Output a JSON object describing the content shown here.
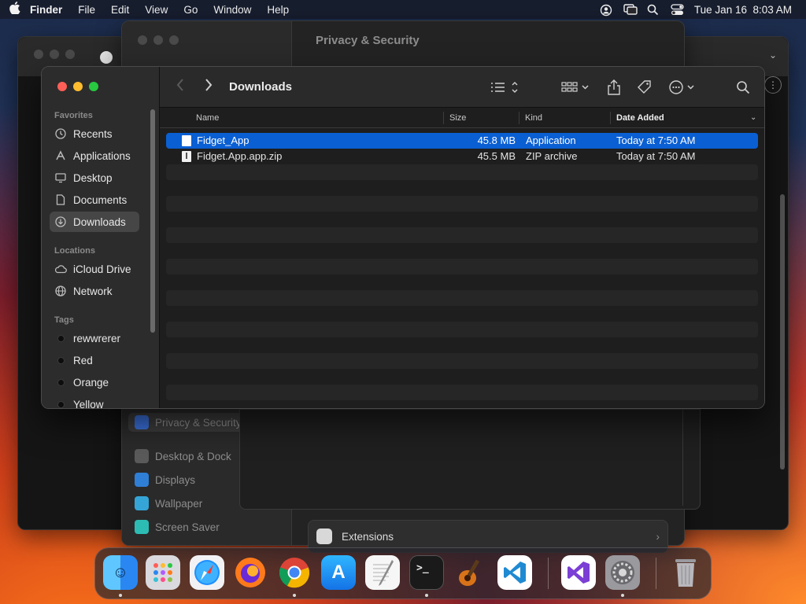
{
  "menubar": {
    "app_name": "Finder",
    "items": [
      "File",
      "Edit",
      "View",
      "Go",
      "Window",
      "Help"
    ],
    "datetime": "Tue Jan 16  8:03 AM",
    "status_icons": [
      "user-switch-icon",
      "screen-mirroring-icon",
      "spotlight-icon",
      "control-center-icon"
    ]
  },
  "settings_window": {
    "title": "Privacy & Security",
    "sidebar_items": [
      {
        "label": "Privacy & Security",
        "icon": "hand-icon",
        "color": "#3a6fd8"
      },
      {
        "label": "Desktop & Dock",
        "icon": "dock-icon",
        "color": "#5a5a5a"
      },
      {
        "label": "Displays",
        "icon": "displays-icon",
        "color": "#2f7fd6"
      },
      {
        "label": "Wallpaper",
        "icon": "wallpaper-icon",
        "color": "#35a4d6"
      },
      {
        "label": "Screen Saver",
        "icon": "screen-saver-icon",
        "color": "#2dbcb4"
      }
    ],
    "extensions_label": "Extensions"
  },
  "finder": {
    "folder_title": "Downloads",
    "sidebar": {
      "favorites_label": "Favorites",
      "favorites": [
        {
          "label": "Recents",
          "icon": "clock-icon"
        },
        {
          "label": "Applications",
          "icon": "applications-icon"
        },
        {
          "label": "Desktop",
          "icon": "desktop-icon"
        },
        {
          "label": "Documents",
          "icon": "document-icon"
        },
        {
          "label": "Downloads",
          "icon": "download-icon",
          "active": true
        }
      ],
      "locations_label": "Locations",
      "locations": [
        {
          "label": "iCloud Drive",
          "icon": "cloud-icon"
        },
        {
          "label": "Network",
          "icon": "globe-icon"
        }
      ],
      "tags_label": "Tags",
      "tags": [
        "rewwrerer",
        "Red",
        "Orange",
        "Yellow"
      ]
    },
    "columns": {
      "name": "Name",
      "size": "Size",
      "kind": "Kind",
      "date_added": "Date Added"
    },
    "files": [
      {
        "name": "Fidget_App",
        "size": "45.8 MB",
        "kind": "Application",
        "date_added": "Today at 7:50 AM",
        "selected": true
      },
      {
        "name": "Fidget.App.app.zip",
        "size": "45.5 MB",
        "kind": "ZIP archive",
        "date_added": "Today at 7:50 AM",
        "selected": false
      }
    ],
    "selection_color": "#0a5fd3"
  },
  "dock": {
    "apps": [
      {
        "name": "Finder",
        "icon": "finder-icon",
        "running": true
      },
      {
        "name": "Launchpad",
        "icon": "launchpad-icon",
        "running": false
      },
      {
        "name": "Safari",
        "icon": "safari-icon",
        "running": false
      },
      {
        "name": "Firefox",
        "icon": "firefox-icon",
        "running": false
      },
      {
        "name": "Google Chrome",
        "icon": "chrome-icon",
        "running": true
      },
      {
        "name": "App Store",
        "icon": "app-store-icon",
        "running": false
      },
      {
        "name": "TextEdit",
        "icon": "textedit-icon",
        "running": false
      },
      {
        "name": "Terminal",
        "icon": "terminal-icon",
        "running": true
      },
      {
        "name": "GarageBand",
        "icon": "garageband-icon",
        "running": false
      },
      {
        "name": "Visual Studio Code",
        "icon": "vscode-icon",
        "running": false
      },
      {
        "name": "Visual Studio",
        "icon": "visual-studio-icon",
        "running": false
      },
      {
        "name": "System Settings",
        "icon": "system-settings-icon",
        "running": true
      },
      {
        "name": "Trash",
        "icon": "trash-icon",
        "running": false
      }
    ]
  }
}
